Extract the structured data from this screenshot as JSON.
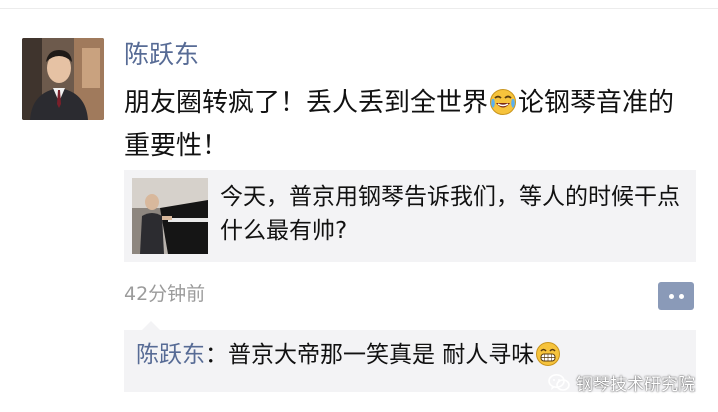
{
  "moment": {
    "author": "陈跃东",
    "text_before_emoji": "朋友圈转疯了！丢人丢到全世界",
    "emoji_1": "crying-laughing-emoji",
    "text_after_emoji": "论钢琴音准的重要性！",
    "link_card": {
      "title": "今天，普京用钢琴告诉我们，等人的时候干点什么最有帅?",
      "thumbnail": "piano-player-thumbnail"
    },
    "timestamp": "42分钟前",
    "comment_button_icon": "comment-dots-icon"
  },
  "comments": [
    {
      "author": "陈跃东",
      "separator": "：",
      "text": "普京大帝那一笑真是 耐人寻味",
      "emoji": "grinning-emoji"
    }
  ],
  "watermark": {
    "text": "钢琴技术研究院",
    "icon": "wechat-icon"
  },
  "colors": {
    "name_link": "#576b95",
    "card_bg": "#f3f3f5",
    "timestamp": "#9b9b9b",
    "comment_button": "#8a9ab8"
  }
}
